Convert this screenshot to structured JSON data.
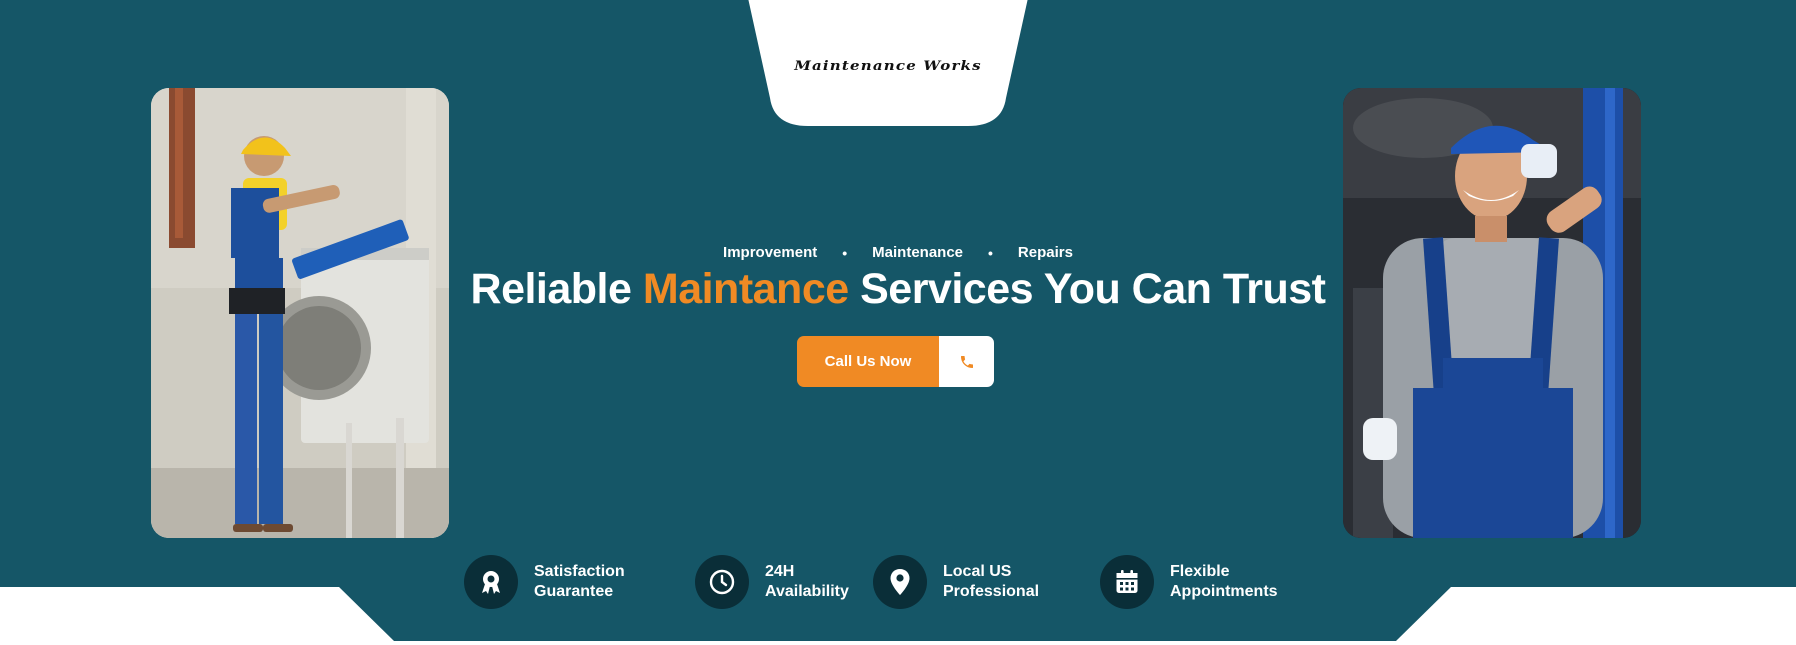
{
  "brand": {
    "logo_text": "Maintenance Works"
  },
  "tagline": {
    "items": [
      "Improvement",
      "Maintenance",
      "Repairs"
    ],
    "separator": "•"
  },
  "headline": {
    "before": "Reliable ",
    "accent": "Maintance",
    "after": " Services You Can Trust"
  },
  "cta": {
    "label": "Call Us Now",
    "icon": "phone-icon"
  },
  "features": [
    {
      "line1": "Satisfaction",
      "line2": "Guarantee",
      "icon": "award-ribbon-icon"
    },
    {
      "line1": "24H",
      "line2": "Availability",
      "icon": "clock-icon"
    },
    {
      "line1": "Local US",
      "line2": "Professional",
      "icon": "location-pin-icon"
    },
    {
      "line1": "Flexible",
      "line2": "Appointments",
      "icon": "calendar-icon"
    }
  ],
  "colors": {
    "primary": "#155667",
    "accent": "#f08a24",
    "icon_bg": "#0a2e38",
    "white": "#ffffff"
  }
}
